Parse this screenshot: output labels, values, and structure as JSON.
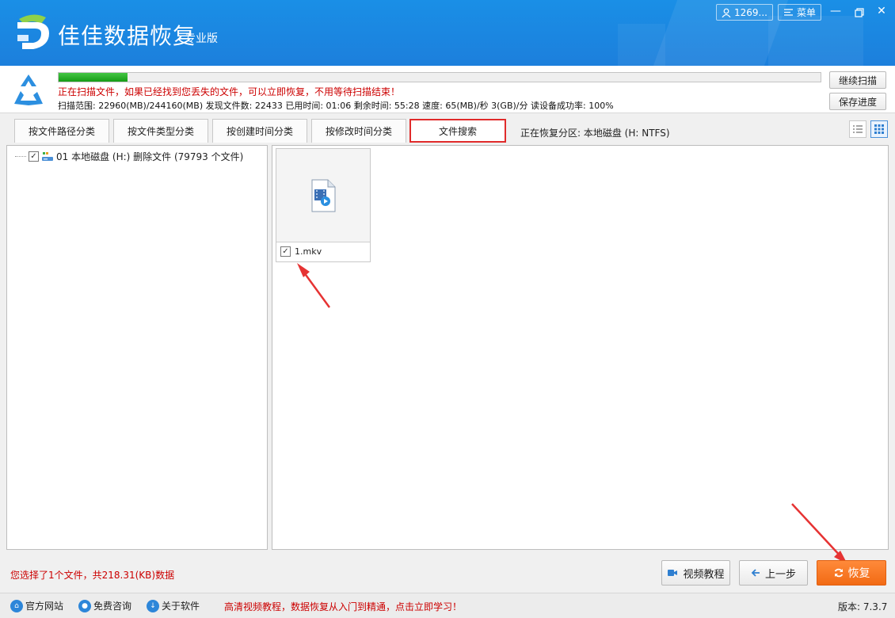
{
  "header": {
    "app_title": "佳佳数据恢复",
    "edition": "专业版",
    "user_label": "1269...",
    "menu_label": "菜单",
    "colors": {
      "primary": "#1c86e2",
      "accent_orange": "#f26a14",
      "alert_red": "#cc0000"
    },
    "icons": [
      "user-icon",
      "menu-icon",
      "minimize-icon",
      "restore-icon",
      "close-icon"
    ]
  },
  "scan": {
    "progress_percent": 9,
    "message": "正在扫描文件，如果已经找到您丢失的文件，可以立即恢复，不用等待扫描结束！",
    "stats": "扫描范围: 22960(MB)/244160(MB)    发现文件数: 22433    已用时间: 01:06    剩余时间: 55:28    速度: 65(MB)/秒  3(GB)/分  读设备成功率: 100%",
    "continue_label": "继续扫描",
    "save_label": "保存进度"
  },
  "tabs": {
    "items": [
      {
        "label": "按文件路径分类"
      },
      {
        "label": "按文件类型分类"
      },
      {
        "label": "按创建时间分类"
      },
      {
        "label": "按修改时间分类"
      },
      {
        "label": "文件搜索"
      }
    ],
    "active_index": 4,
    "partition_info": "正在恢复分区: 本地磁盘 (H: NTFS)",
    "view_modes": [
      "list-view-icon",
      "grid-view-icon"
    ],
    "active_view": "grid"
  },
  "tree": {
    "root": {
      "label": "01 本地磁盘 (H:) 删除文件  (79793 个文件)",
      "checked": true
    }
  },
  "files": [
    {
      "name": "1.mkv",
      "checked": true,
      "icon": "video-file-icon"
    }
  ],
  "footer": {
    "selected_info": "您选择了1个文件，共218.31(KB)数据",
    "video_tutorial_label": "视频教程",
    "prev_label": "上一步",
    "recover_label": "恢复"
  },
  "statusbar": {
    "official_site": "官方网站",
    "free_consult": "免费咨询",
    "about": "关于软件",
    "promo": "高清视频教程，数据恢复从入门到精通，点击立即学习！",
    "version": "版本: 7.3.7"
  }
}
